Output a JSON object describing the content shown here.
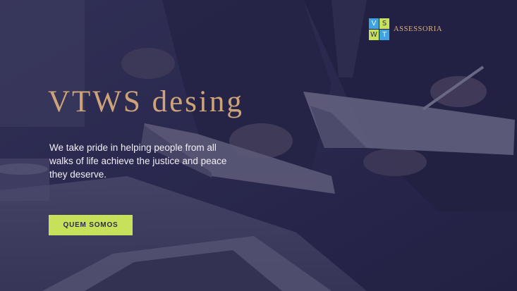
{
  "logo": {
    "letters": [
      "V",
      "S",
      "W",
      "T"
    ]
  },
  "brand": {
    "name": "ASSESSORIA"
  },
  "hero": {
    "title": "VTWS desing",
    "tagline": "We take pride in helping people from all walks of life achieve the justice and peace they deserve.",
    "cta_label": "QUEM SOMOS"
  },
  "colors": {
    "accent": "#c7e25a",
    "title": "#cfa37a",
    "overlay": "#28264e",
    "logo_blue": "#3ea3e0"
  }
}
